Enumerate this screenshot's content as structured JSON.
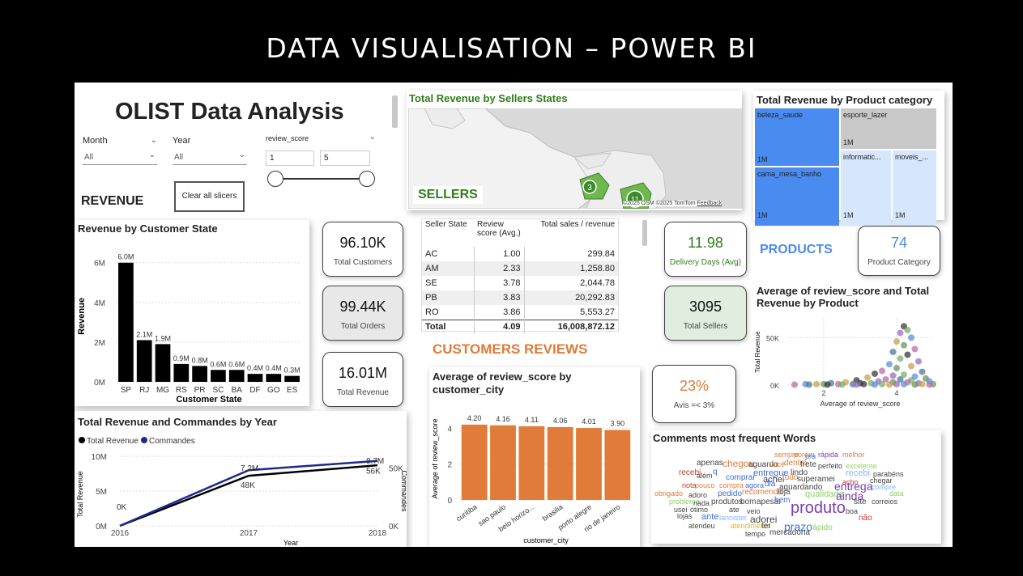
{
  "slide_title": "DATA VISUALISATION – POWER BI",
  "report": {
    "title": "OLIST Data Analysis",
    "section_revenue": "REVENUE",
    "section_sellers": "SELLERS",
    "section_products": "PRODUCTS",
    "section_reviews": "CUSTOMERS REVIEWS"
  },
  "slicers": {
    "month": {
      "label": "Month",
      "value": "All"
    },
    "year": {
      "label": "Year",
      "value": "All"
    },
    "review": {
      "label": "review_score",
      "min": "1",
      "max": "5"
    },
    "clear_label": "Clear all slicers"
  },
  "cards": {
    "total_customers": {
      "value": "96.10K",
      "label": "Total Customers"
    },
    "total_orders": {
      "value": "99.44K",
      "label": "Total Orders"
    },
    "total_revenue": {
      "value": "16.01M",
      "label": "Total Revenue"
    },
    "delivery_days": {
      "value": "11.98",
      "label": "Delivery Days (Avg)"
    },
    "total_sellers": {
      "value": "3095",
      "label": "Total Sellers"
    },
    "product_category": {
      "value": "74",
      "label": "Product Category"
    },
    "avis": {
      "value": "23%",
      "label": "Avis =< 3%"
    }
  },
  "map": {
    "title": "Total Revenue by Sellers States",
    "bubbles": [
      "3",
      "11"
    ],
    "credit": "©2025 OSM ©2025 TomTom",
    "feedback": "Feedback"
  },
  "seller_table": {
    "headers": [
      "Seller State",
      "Review score (Avg.)",
      "Total sales / revenue"
    ],
    "rows": [
      [
        "AC",
        "1.00",
        "299.84"
      ],
      [
        "AM",
        "2.33",
        "1,258.80"
      ],
      [
        "SE",
        "3.78",
        "2,044.78"
      ],
      [
        "PB",
        "3.83",
        "20,292.83"
      ],
      [
        "RO",
        "3.86",
        "5,553.27"
      ]
    ],
    "total": [
      "Total",
      "4.09",
      "16,008,872.12"
    ]
  },
  "treemap": {
    "title": "Total Revenue by Product category",
    "tiles": [
      {
        "name": "beleza_saude",
        "value": "1M"
      },
      {
        "name": "esporte_lazer",
        "value": "1M"
      },
      {
        "name": "cama_mesa_banho",
        "value": "1M"
      },
      {
        "name": "informatic...",
        "value": "1M"
      },
      {
        "name": "moveis_...",
        "value": "1M"
      }
    ],
    "colors": {
      "primary": "#4a8bf0",
      "light": "#d6e6fd",
      "gray": "#c8c8c8"
    }
  },
  "scatter_title": "Average of review_score and Total Revenue by Product",
  "wordcloud": {
    "title": "Comments most frequent Words",
    "words": [
      {
        "t": "sempre",
        "c": "#e07b39"
      },
      {
        "t": "porém",
        "c": "#e07b39"
      },
      {
        "t": "pra",
        "c": "#3b6ddb"
      },
      {
        "t": "rápida",
        "c": "#7a3db8"
      },
      {
        "t": "melhor",
        "c": "#e07b39"
      },
      {
        "t": "apenas",
        "c": "#444"
      },
      {
        "t": "chegou",
        "c": "#e07b39"
      },
      {
        "t": "aguardo",
        "c": "#444"
      },
      {
        "t": "você",
        "c": "#e07b39"
      },
      {
        "t": "dentro",
        "c": "#e07b39"
      },
      {
        "t": "frete",
        "c": "#444"
      },
      {
        "t": "perfeito",
        "c": "#444"
      },
      {
        "t": "excelente",
        "c": "#8fcf6a"
      },
      {
        "t": "recebi",
        "c": "#c0392b"
      },
      {
        "t": "q",
        "c": "#3b6ddb"
      },
      {
        "t": "entregue",
        "c": "#3b6ddb"
      },
      {
        "t": "lindo",
        "c": "#444"
      },
      {
        "t": "recebi",
        "c": "#8ab4f8"
      },
      {
        "t": "parabéns",
        "c": "#444"
      },
      {
        "t": "além",
        "c": "#444"
      },
      {
        "t": "comprar",
        "c": "#3b6ddb"
      },
      {
        "t": "achei",
        "c": "#444"
      },
      {
        "t": "tudo",
        "c": "#e07b39"
      },
      {
        "t": "superamei",
        "c": "#444"
      },
      {
        "t": "acho",
        "c": "#c0392b"
      },
      {
        "t": "chegar",
        "c": "#444"
      },
      {
        "t": "nota",
        "c": "#c0392b"
      },
      {
        "t": "pouco",
        "c": "#e07b39"
      },
      {
        "t": "compra",
        "c": "#e07b39"
      },
      {
        "t": "agora",
        "c": "#3b6ddb"
      },
      {
        "t": "dia",
        "c": "#3b6ddb"
      },
      {
        "t": "aguardando",
        "c": "#444"
      },
      {
        "t": "entrega",
        "c": "#7a3db8"
      },
      {
        "t": "compre",
        "c": "#8ab4f8"
      },
      {
        "t": "obrigado",
        "c": "#e07b39"
      },
      {
        "t": "adoro",
        "c": "#444"
      },
      {
        "t": "pedido",
        "c": "#3b6ddb"
      },
      {
        "t": "recomendo",
        "c": "#e07b39"
      },
      {
        "t": "loja",
        "c": "#444"
      },
      {
        "t": "qualidade",
        "c": "#8fcf6a"
      },
      {
        "t": "ainda",
        "c": "#7a3db8"
      },
      {
        "t": "data",
        "c": "#8fcf6a"
      },
      {
        "t": "problema",
        "c": "#8fcf6a"
      },
      {
        "t": "nada",
        "c": "#444"
      },
      {
        "t": "produtos",
        "c": "#444"
      },
      {
        "t": "bom",
        "c": "#444"
      },
      {
        "t": "apesar",
        "c": "#444"
      },
      {
        "t": "bem",
        "c": "#3b6ddb"
      },
      {
        "t": "site",
        "c": "#444"
      },
      {
        "t": "correios",
        "c": "#444"
      },
      {
        "t": "usei",
        "c": "#444"
      },
      {
        "t": "ótimo",
        "c": "#444"
      },
      {
        "t": "ate",
        "c": "#444"
      },
      {
        "t": "veio",
        "c": "#444"
      },
      {
        "t": "produto",
        "c": "#7a3db8"
      },
      {
        "t": "boa",
        "c": "#444"
      },
      {
        "t": "lojas",
        "c": "#444"
      },
      {
        "t": "ante",
        "c": "#3b6ddb"
      },
      {
        "t": "lannister",
        "c": "#8ab4f8"
      },
      {
        "t": "adorei",
        "c": "#444"
      },
      {
        "t": "não",
        "c": "#c0392b"
      },
      {
        "t": "atendeu",
        "c": "#444"
      },
      {
        "t": "atendimento",
        "c": "#e0b030"
      },
      {
        "t": "ter",
        "c": "#444"
      },
      {
        "t": "prazo",
        "c": "#3b6ddb"
      },
      {
        "t": "rápido",
        "c": "#8fcf6a"
      },
      {
        "t": "tempo",
        "c": "#444"
      },
      {
        "t": "mercadoria",
        "c": "#444"
      }
    ]
  },
  "colors": {
    "accent_blue": "#4a8bf0",
    "reviews_orange": "#e07b39",
    "sellers_green": "#2f7d1a",
    "bar_black": "#000000",
    "bar_orange": "#e07b39",
    "commandes_navy": "#1f2a8c"
  },
  "chart_data": [
    {
      "type": "bar",
      "title": "Revenue by Customer State",
      "xlabel": "Customer State",
      "ylabel": "Revenue",
      "categories": [
        "SP",
        "RJ",
        "MG",
        "RS",
        "PR",
        "SC",
        "BA",
        "DF",
        "GO",
        "ES"
      ],
      "values": [
        6.0,
        2.1,
        1.9,
        0.9,
        0.8,
        0.6,
        0.6,
        0.4,
        0.4,
        0.3
      ],
      "data_labels": [
        "6.0M",
        "2.1M",
        "1.9M",
        "0.9M",
        "0.8M",
        "0.6M",
        "0.6M",
        "0.4M",
        "0.4M",
        "0.3M"
      ],
      "y_ticks": [
        "0M",
        "2M",
        "4M",
        "6M"
      ],
      "ylim": [
        0,
        6.6
      ],
      "unit": "M",
      "grid": true
    },
    {
      "type": "line",
      "title": "Total Revenue and Commandes by Year",
      "xlabel": "Year",
      "ylabel": "Total Revenue",
      "y2label": "Commandes",
      "x": [
        "2016",
        "2017",
        "2018"
      ],
      "series": [
        {
          "name": "Total Revenue",
          "values": [
            0,
            7.2,
            8.7
          ],
          "labels": [
            "0K",
            "7.2M",
            "8.7M"
          ],
          "color": "#000000"
        },
        {
          "name": "Commandes",
          "values": [
            0,
            48,
            56
          ],
          "labels": [
            "0K",
            "48K",
            "56K"
          ],
          "color": "#1f2a8c"
        }
      ],
      "y_ticks": [
        "0M",
        "5M",
        "10M"
      ],
      "y2_ticks": [
        "0K",
        "50K"
      ],
      "ylim": [
        0,
        10
      ],
      "y2lim": [
        0,
        60
      ],
      "legend": "top-left",
      "grid": true
    },
    {
      "type": "bar",
      "title": "Average of review_score by customer_city",
      "xlabel": "customer_city",
      "ylabel": "Average of review_score",
      "categories": [
        "curitiba",
        "sao paulo",
        "belo horizo...",
        "brasilia",
        "porto alegre",
        "rio de janeiro"
      ],
      "values": [
        4.2,
        4.16,
        4.11,
        4.06,
        4.01,
        3.9
      ],
      "data_labels": [
        "4.20",
        "4.16",
        "4.11",
        "4.06",
        "4.01",
        "3.90"
      ],
      "y_ticks": [
        "0",
        "2",
        "4"
      ],
      "ylim": [
        0,
        4.6
      ],
      "grid": true
    },
    {
      "type": "scatter",
      "title": "Average of review_score and Total Revenue by Product",
      "xlabel": "Average of review_score",
      "ylabel": "Total Revenue",
      "x_ticks": [
        "2",
        "4"
      ],
      "y_ticks": [
        "0K",
        "50K"
      ],
      "xlim": [
        1,
        5
      ],
      "ylim": [
        0,
        70
      ],
      "points": [
        {
          "x": 4.2,
          "y": 62
        },
        {
          "x": 4.3,
          "y": 58
        },
        {
          "x": 4.1,
          "y": 55
        },
        {
          "x": 4.4,
          "y": 50
        },
        {
          "x": 4.0,
          "y": 46
        },
        {
          "x": 4.2,
          "y": 42
        },
        {
          "x": 4.5,
          "y": 38
        },
        {
          "x": 3.9,
          "y": 35
        },
        {
          "x": 4.3,
          "y": 32
        },
        {
          "x": 4.1,
          "y": 28
        },
        {
          "x": 4.6,
          "y": 25
        },
        {
          "x": 3.8,
          "y": 22
        },
        {
          "x": 4.4,
          "y": 20
        },
        {
          "x": 4.0,
          "y": 18
        },
        {
          "x": 3.6,
          "y": 15
        },
        {
          "x": 4.7,
          "y": 14
        },
        {
          "x": 3.4,
          "y": 12
        },
        {
          "x": 4.2,
          "y": 11
        },
        {
          "x": 3.9,
          "y": 10
        },
        {
          "x": 4.5,
          "y": 9
        },
        {
          "x": 3.2,
          "y": 8
        },
        {
          "x": 4.8,
          "y": 7
        },
        {
          "x": 3.7,
          "y": 6
        },
        {
          "x": 4.1,
          "y": 6
        },
        {
          "x": 2.9,
          "y": 5
        },
        {
          "x": 4.4,
          "y": 5
        },
        {
          "x": 3.5,
          "y": 4
        },
        {
          "x": 4.9,
          "y": 4
        },
        {
          "x": 2.6,
          "y": 3
        },
        {
          "x": 3.9,
          "y": 3
        },
        {
          "x": 4.3,
          "y": 3
        },
        {
          "x": 2.2,
          "y": 2
        },
        {
          "x": 3.0,
          "y": 2
        },
        {
          "x": 3.3,
          "y": 2
        },
        {
          "x": 4.6,
          "y": 2
        },
        {
          "x": 1.5,
          "y": 1
        },
        {
          "x": 1.8,
          "y": 1
        },
        {
          "x": 2.0,
          "y": 1
        },
        {
          "x": 2.4,
          "y": 1
        },
        {
          "x": 2.8,
          "y": 1
        },
        {
          "x": 3.1,
          "y": 1
        },
        {
          "x": 3.6,
          "y": 1
        },
        {
          "x": 4.0,
          "y": 1
        },
        {
          "x": 4.2,
          "y": 1
        },
        {
          "x": 4.7,
          "y": 1
        },
        {
          "x": 5.0,
          "y": 1
        },
        {
          "x": 1.2,
          "y": 0.5
        },
        {
          "x": 1.6,
          "y": 0.5
        },
        {
          "x": 2.1,
          "y": 0.5
        },
        {
          "x": 2.5,
          "y": 0.5
        },
        {
          "x": 2.9,
          "y": 0.5
        },
        {
          "x": 3.4,
          "y": 0.5
        },
        {
          "x": 3.8,
          "y": 0.5
        },
        {
          "x": 4.5,
          "y": 0.5
        },
        {
          "x": 4.9,
          "y": 0.5
        }
      ],
      "palette": [
        "#3a3a3a",
        "#7bb06a",
        "#9a6fc2",
        "#5c8fd6",
        "#c9a24a",
        "#6a9a55",
        "#b86fa8",
        "#4e7a9a"
      ]
    }
  ]
}
